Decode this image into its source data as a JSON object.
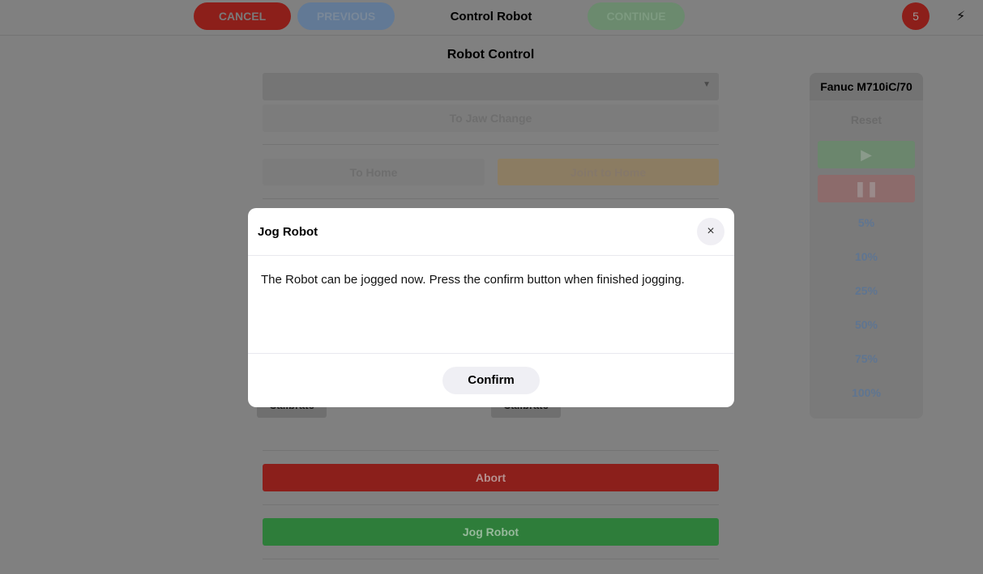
{
  "topbar": {
    "cancel": "CANCEL",
    "previous": "PREVIOUS",
    "title": "Control Robot",
    "continue": "CONTINUE",
    "badge": "5",
    "icon": "bolt-icon"
  },
  "main": {
    "title": "Robot Control",
    "select_value": "",
    "to_jaw_change": "To Jaw Change",
    "to_home": "To Home",
    "joint_to_home": "Joint to Home",
    "calibrate_left": "Calibrate",
    "calibrate_right": "Calibrate",
    "abort": "Abort",
    "jog_robot": "Jog Robot"
  },
  "side": {
    "title": "Fanuc M710iC/70",
    "reset": "Reset",
    "play_icon": "play-icon",
    "pause_icon": "pause-icon",
    "speeds": [
      "5%",
      "10%",
      "25%",
      "50%",
      "75%",
      "100%"
    ]
  },
  "modal": {
    "title": "Jog Robot",
    "message": "The Robot can be jogged now. Press the confirm button when finished jogging.",
    "confirm": "Confirm",
    "close_icon": "close-icon"
  }
}
